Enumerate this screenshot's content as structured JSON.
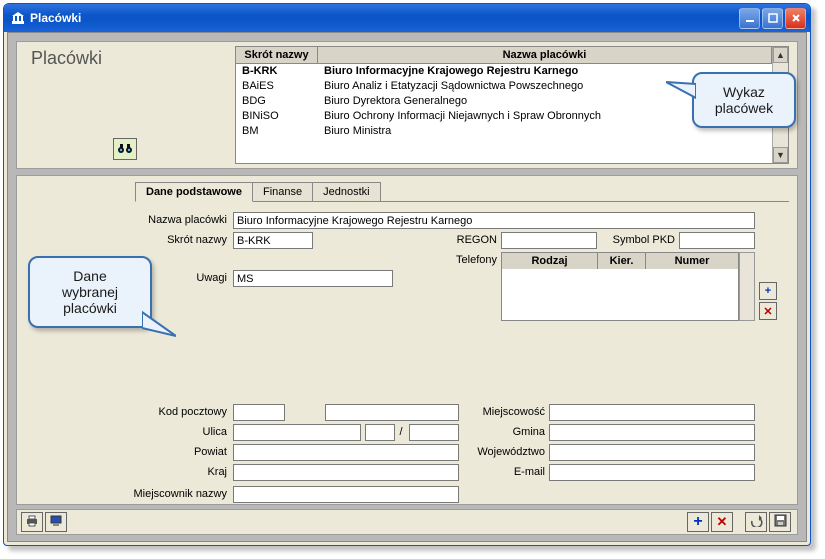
{
  "window": {
    "title": "Placówki"
  },
  "heading": "Placówki",
  "grid": {
    "headers": {
      "skrot": "Skrót nazwy",
      "nazwa": "Nazwa placówki"
    },
    "rows": [
      {
        "skrot": "B-KRK",
        "nazwa": "Biuro Informacyjne Krajowego Rejestru Karnego",
        "selected": true
      },
      {
        "skrot": "BAiES",
        "nazwa": "Biuro Analiz i Etatyzacji Sądownictwa  Powszechnego"
      },
      {
        "skrot": "BDG",
        "nazwa": "Biuro Dyrektora Generalnego"
      },
      {
        "skrot": "BINiSO",
        "nazwa": "Biuro Ochrony Informacji Niejawnych i Spraw Obronnych"
      },
      {
        "skrot": "BM",
        "nazwa": "Biuro Ministra"
      }
    ]
  },
  "tabs": {
    "basic": "Dane podstawowe",
    "finance": "Finanse",
    "units": "Jednostki"
  },
  "form": {
    "labels": {
      "nazwa": "Nazwa placówki",
      "skrot": "Skrót nazwy",
      "regon": "REGON",
      "pkd": "Symbol PKD",
      "uwagi": "Uwagi",
      "telefony": "Telefony",
      "kod": "Kod pocztowy",
      "miejscowosc": "Miejscowość",
      "ulica": "Ulica",
      "gmina": "Gmina",
      "powiat": "Powiat",
      "woj": "Województwo",
      "kraj": "Kraj",
      "email": "E-mail",
      "miejscownik": "Miejscownik nazwy"
    },
    "values": {
      "nazwa": "Biuro Informacyjne Krajowego Rejestru Karnego",
      "skrot": "B-KRK",
      "regon": "",
      "pkd": "",
      "uwagi": "MS",
      "kod": "",
      "kod2": "",
      "miejscowosc": "",
      "ulica": "",
      "ulica_nr": "",
      "ulica_nr2": "",
      "ulica_sep": "/",
      "gmina": "",
      "powiat": "",
      "woj": "",
      "kraj": "",
      "email": "",
      "miejscownik": ""
    },
    "tel_headers": {
      "rodzaj": "Rodzaj",
      "kier": "Kier.",
      "numer": "Numer"
    }
  },
  "callouts": {
    "right": "Wykaz placówek",
    "left1": "Dane wybranej",
    "left2": "placówki"
  }
}
